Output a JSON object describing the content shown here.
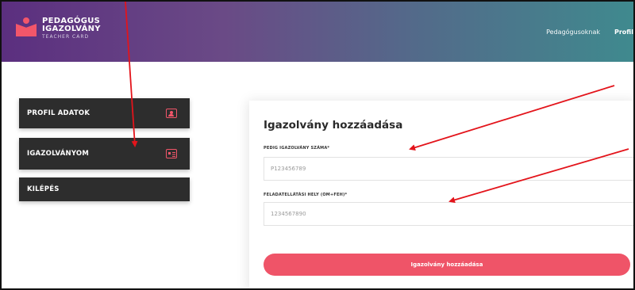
{
  "header": {
    "logo_line1": "PEDAGÓGUS",
    "logo_line2": "IGAZOLVÁNY",
    "logo_line3": "TEACHER CARD",
    "nav": [
      {
        "label": "Pedagógusoknak"
      },
      {
        "label": "Profil"
      }
    ]
  },
  "sidebar": {
    "items": [
      {
        "label": "PROFIL ADATOK",
        "icon": "user-card-icon"
      },
      {
        "label": "IGAZOLVÁNYOM",
        "icon": "id-card-icon"
      },
      {
        "label": "KILÉPÉS"
      }
    ]
  },
  "form": {
    "title": "Igazolvány hozzáadása",
    "field1_label": "PEDIG IGAZOLVÁNY SZÁMA*",
    "field1_value": "P123456789",
    "field2_label": "FELADATELLÁTÁSI HELY (OM+FEH)*",
    "field2_value": "1234567890",
    "submit_label": "Igazolvány hozzáadása"
  },
  "colors": {
    "accent": "#ef5468",
    "sidebar_bg": "#2d2d2d",
    "annotation_arrow": "#e3141b"
  }
}
